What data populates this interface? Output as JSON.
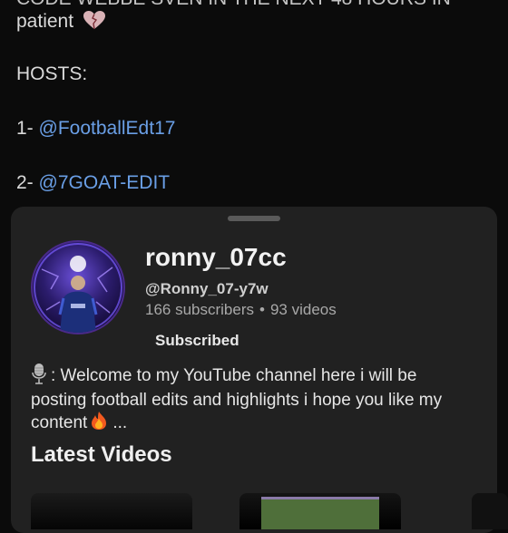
{
  "post": {
    "cut_text": "CODE WEBBE SVEN IN THE NEXT 48 HOURS IN",
    "line_patient": "patient",
    "hosts_label": "HOSTS:",
    "host1_prefix": "1- ",
    "host1_link": "@FootballEdt17",
    "host2_prefix": "2- ",
    "host2_link": "@7GOAT-EDIT"
  },
  "channel": {
    "name": "ronny_07cc",
    "handle": "@Ronny_07-y7w",
    "subscribers": "166 subscribers",
    "separator": "•",
    "videos": "93 videos",
    "subscribe_label": "Subscribed",
    "description_main": ": Welcome to my YouTube channel here i will be posting football edits and highlights i hope you like my content",
    "description_more": "..."
  },
  "section": {
    "latest_title": "Latest Videos"
  },
  "icons": [
    "heart-icon",
    "microphone-icon",
    "fire-icon"
  ],
  "colors": {
    "link": "#6a9fe6",
    "sheet": "#212121",
    "background": "#0b0b0b"
  }
}
